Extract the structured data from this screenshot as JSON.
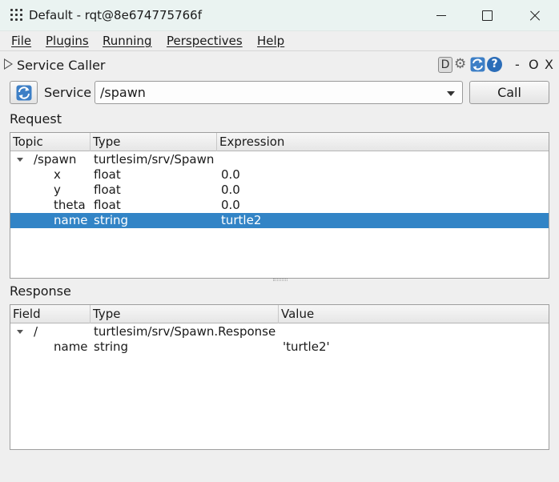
{
  "window": {
    "title": "Default - rqt@8e674775766f"
  },
  "menu": [
    "File",
    "Plugins",
    "Running",
    "Perspectives",
    "Help"
  ],
  "plugin": {
    "title": "Service Caller",
    "toolbar": {
      "d_label": "D",
      "help_label": "?",
      "minimize_label": "-",
      "float_label": "O",
      "close_label": "X"
    }
  },
  "service": {
    "label": "Service",
    "selected": "/spawn",
    "call_label": "Call"
  },
  "request": {
    "label": "Request",
    "columns": [
      "Topic",
      "Type",
      "Expression"
    ],
    "rows": [
      {
        "topic": "/spawn",
        "type": "turtlesim/srv/Spawn",
        "expression": "",
        "depth": 0,
        "expanded": true
      },
      {
        "topic": "x",
        "type": "float",
        "expression": "0.0",
        "depth": 1
      },
      {
        "topic": "y",
        "type": "float",
        "expression": "0.0",
        "depth": 1
      },
      {
        "topic": "theta",
        "type": "float",
        "expression": "0.0",
        "depth": 1
      },
      {
        "topic": "name",
        "type": "string",
        "expression": "turtle2",
        "depth": 1,
        "selected": true
      }
    ]
  },
  "response": {
    "label": "Response",
    "columns": [
      "Field",
      "Type",
      "Value"
    ],
    "rows": [
      {
        "field": "/",
        "type": "turtlesim/srv/Spawn.Response",
        "value": "",
        "depth": 0,
        "expanded": true
      },
      {
        "field": "name",
        "type": "string",
        "value": "'turtle2'",
        "depth": 1
      }
    ]
  },
  "colors": {
    "selection": "#3284c6",
    "titlebar": "#eaf3f1",
    "help_icon": "#2b6db8"
  }
}
